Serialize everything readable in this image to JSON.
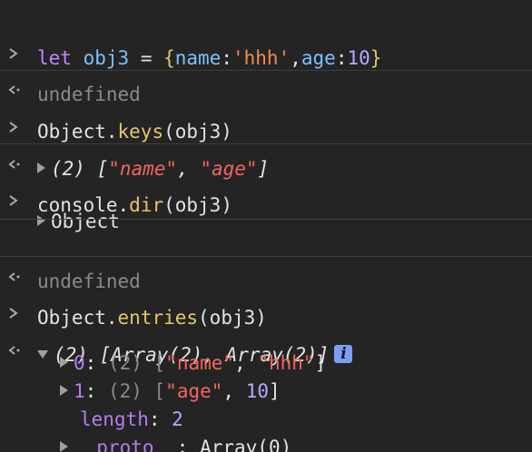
{
  "lines": {
    "l1": {
      "kw": "let",
      "var": "obj3",
      "eq": " = ",
      "open": "{",
      "k1": "name",
      "colon": ":",
      "v1": "'hhh'",
      "comma": ",",
      "k2": "age",
      "v2": "10",
      "close": "}"
    },
    "l2": {
      "text": "undefined"
    },
    "l3": {
      "obj": "Object",
      "dot": ".",
      "method": "keys",
      "args": "(obj3)"
    },
    "l4": {
      "count": "(2) [",
      "s1": "\"name\"",
      "sep": ", ",
      "s2": "\"age\"",
      "end": "]"
    },
    "l5": {
      "obj": "console",
      "dot": ".",
      "method": "dir",
      "args": "(obj3)"
    },
    "l6": {
      "text": "Object"
    },
    "l7": {
      "text": "undefined"
    },
    "l8": {
      "obj": "Object",
      "dot": ".",
      "method": "entries",
      "args": "(obj3)"
    },
    "l9": {
      "summary": "(2) [Array(2), Array(2)]",
      "info": "i"
    },
    "l10": {
      "key": "0",
      "colon": ": ",
      "count": "(2) [",
      "s1": "\"name\"",
      "sep": ", ",
      "s2": "\"hhh\"",
      "end": "]"
    },
    "l11": {
      "key": "1",
      "colon": ": ",
      "count": "(2) [",
      "s1": "\"age\"",
      "sep": ", ",
      "n2": "10",
      "end": "]"
    },
    "l12": {
      "key": "length",
      "colon": ": ",
      "val": "2"
    },
    "l13": {
      "key": "__proto__",
      "colon": ": ",
      "val": "Array(0)"
    }
  }
}
